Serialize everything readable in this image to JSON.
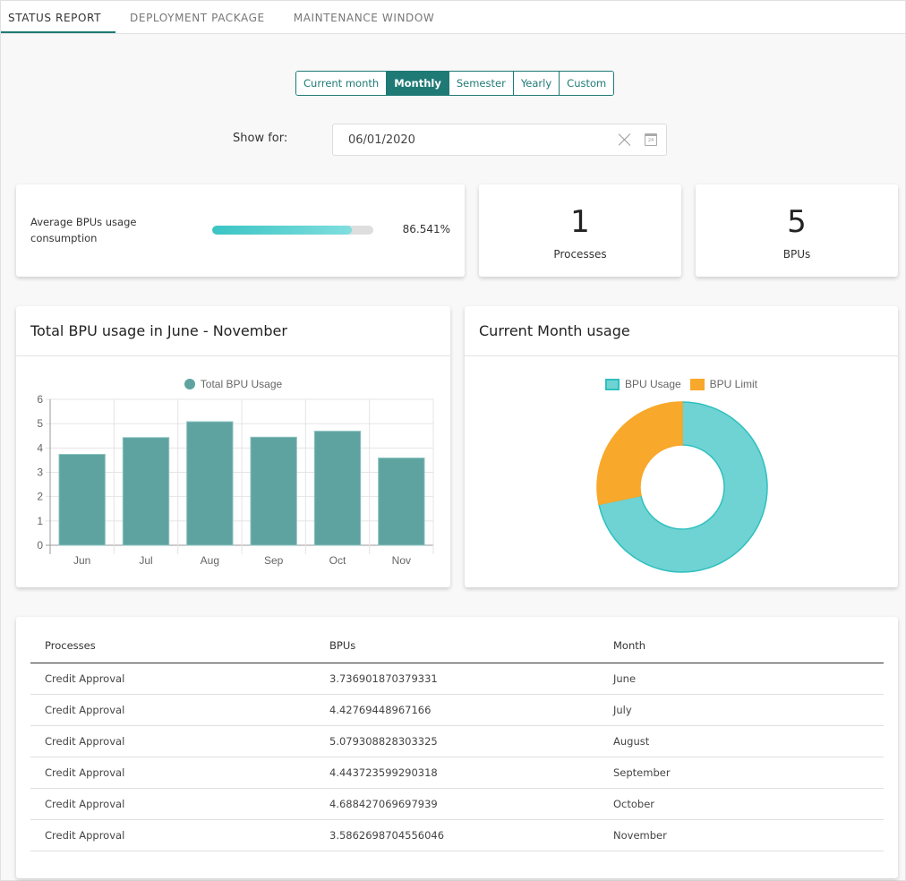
{
  "tabs": [
    {
      "label": "STATUS REPORT",
      "active": true
    },
    {
      "label": "DEPLOYMENT PACKAGE",
      "active": false
    },
    {
      "label": "MAINTENANCE WINDOW",
      "active": false
    }
  ],
  "period_selector": {
    "options": [
      "Current month",
      "Monthly",
      "Semester",
      "Yearly",
      "Custom"
    ],
    "selected": "Monthly"
  },
  "show_for": {
    "label": "Show for:",
    "date_value": "06/01/2020",
    "clear_icon": "close-icon",
    "calendar_icon": "calendar-icon",
    "calendar_day": "24"
  },
  "summary": {
    "avg_label": "Average BPUs usage consumption",
    "avg_percent": 86.541,
    "avg_value_text": "86.541%",
    "processes_count": "1",
    "processes_label": "Processes",
    "bpus_count": "5",
    "bpus_label": "BPUs"
  },
  "colors": {
    "accent": "#1f7a75",
    "bar": "#5ea3a0",
    "usage": "#6fd3d3",
    "usage_border": "#2fbfbf",
    "limit": "#f8a82a"
  },
  "bar_panel": {
    "title": "Total BPU usage in June - November"
  },
  "donut_panel": {
    "title": "Current Month usage"
  },
  "chart_data": [
    {
      "type": "bar",
      "title": "Total BPU usage in June - November",
      "legend": [
        "Total BPU Usage"
      ],
      "legend_position": "top",
      "categories": [
        "Jun",
        "Jul",
        "Aug",
        "Sep",
        "Oct",
        "Nov"
      ],
      "values": [
        3.736901870379331,
        4.42769448967166,
        5.079308828303325,
        4.443723599290318,
        4.688427069697939,
        3.5862698704556046
      ],
      "yticks": [
        "0",
        "1",
        "2",
        "3",
        "4",
        "5",
        "6"
      ],
      "ylim": [
        0,
        6
      ],
      "grid": true,
      "xlabel": "",
      "ylabel": ""
    },
    {
      "type": "pie",
      "subtype": "doughnut",
      "title": "Current Month usage",
      "legend": [
        "BPU Usage",
        "BPU Limit"
      ],
      "legend_position": "top",
      "labels": [
        "BPU Usage",
        "BPU Limit"
      ],
      "values": [
        3.5862698704556046,
        1.4137301295443954
      ]
    }
  ],
  "table": {
    "headers": [
      "Processes",
      "BPUs",
      "Month"
    ],
    "rows": [
      [
        "Credit Approval",
        "3.736901870379331",
        "June"
      ],
      [
        "Credit Approval",
        "4.42769448967166",
        "July"
      ],
      [
        "Credit Approval",
        "5.079308828303325",
        "August"
      ],
      [
        "Credit Approval",
        "4.443723599290318",
        "September"
      ],
      [
        "Credit Approval",
        "4.688427069697939",
        "October"
      ],
      [
        "Credit Approval",
        "3.5862698704556046",
        "November"
      ]
    ]
  }
}
